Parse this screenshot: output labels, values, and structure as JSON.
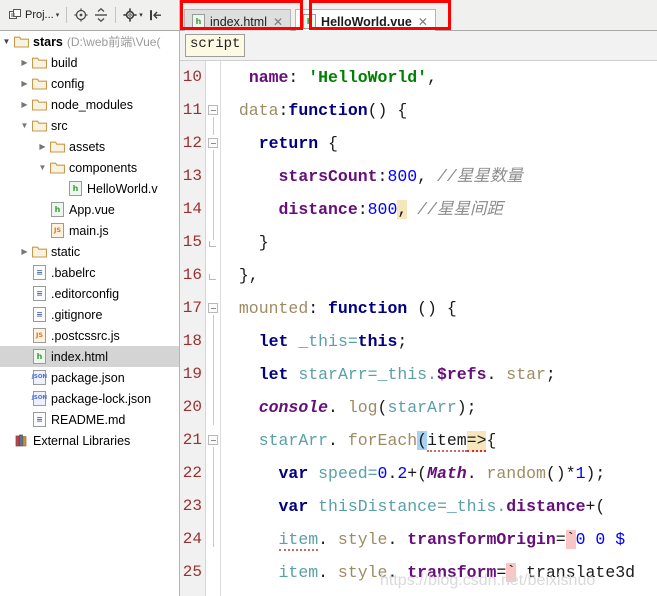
{
  "toolbar": {
    "project_button_label": "Proj...",
    "caret_glyph": "▾",
    "icons": [
      "project-dropdown-icon",
      "locate-target-icon",
      "collapse-all-icon",
      "settings-gear-icon",
      "hide-panel-icon"
    ]
  },
  "tabs": [
    {
      "label": "index.html",
      "icon": "html-file-icon",
      "icon_letter": "h",
      "close_glyph": "✕",
      "active": false,
      "annotated": true
    },
    {
      "label": "HelloWorld.vue",
      "icon": "vue-file-icon",
      "icon_letter": "h",
      "close_glyph": "✕",
      "active": true,
      "annotated": true
    }
  ],
  "project_tree": {
    "root": {
      "label": "stars",
      "path": "(D:\\web前端\\Vue(",
      "arrow": "▼"
    },
    "items": [
      {
        "label": "build",
        "depth": 1,
        "arrow": "▶",
        "icon": "folder-icon"
      },
      {
        "label": "config",
        "depth": 1,
        "arrow": "▶",
        "icon": "folder-icon"
      },
      {
        "label": "node_modules",
        "depth": 1,
        "arrow": "▶",
        "icon": "folder-icon"
      },
      {
        "label": "src",
        "depth": 1,
        "arrow": "▼",
        "icon": "folder-icon"
      },
      {
        "label": "assets",
        "depth": 2,
        "arrow": "▶",
        "icon": "folder-icon"
      },
      {
        "label": "components",
        "depth": 2,
        "arrow": "▼",
        "icon": "folder-icon"
      },
      {
        "label": "HelloWorld.v",
        "depth": 3,
        "arrow": "",
        "icon": "vue-file-icon",
        "icon_letter": "h",
        "icon_kind": "vue"
      },
      {
        "label": "App.vue",
        "depth": 2,
        "arrow": "",
        "icon": "vue-file-icon",
        "icon_letter": "h",
        "icon_kind": "vue"
      },
      {
        "label": "main.js",
        "depth": 2,
        "arrow": "",
        "icon": "js-file-icon",
        "icon_letter": "JS",
        "icon_kind": "js"
      },
      {
        "label": "static",
        "depth": 1,
        "arrow": "▶",
        "icon": "folder-icon"
      },
      {
        "label": ".babelrc",
        "depth": 1,
        "arrow": "",
        "icon": "text-file-icon",
        "icon_letter": "≡",
        "icon_kind": "txt"
      },
      {
        "label": ".editorconfig",
        "depth": 1,
        "arrow": "",
        "icon": "text-file-icon",
        "icon_letter": "≡",
        "icon_kind": "txt"
      },
      {
        "label": ".gitignore",
        "depth": 1,
        "arrow": "",
        "icon": "text-file-icon",
        "icon_letter": "≡",
        "icon_kind": "txt"
      },
      {
        "label": ".postcssrc.js",
        "depth": 1,
        "arrow": "",
        "icon": "js-file-icon",
        "icon_letter": "JS",
        "icon_kind": "js"
      },
      {
        "label": "index.html",
        "depth": 1,
        "arrow": "",
        "icon": "html-file-icon",
        "icon_letter": "h",
        "icon_kind": "vue",
        "selected": true
      },
      {
        "label": "package.json",
        "depth": 1,
        "arrow": "",
        "icon": "json-file-icon",
        "icon_letter": "JSON",
        "icon_kind": "json"
      },
      {
        "label": "package-lock.json",
        "depth": 1,
        "arrow": "",
        "icon": "json-file-icon",
        "icon_letter": "JSON",
        "icon_kind": "json"
      },
      {
        "label": "README.md",
        "depth": 1,
        "arrow": "",
        "icon": "text-file-icon",
        "icon_letter": "≡",
        "icon_kind": "txt"
      },
      {
        "label": "External Libraries",
        "depth": 0,
        "arrow": "",
        "icon": "libraries-icon"
      }
    ]
  },
  "editor": {
    "breadcrumb": "script",
    "first_line_number": 10,
    "line_numbers": [
      10,
      11,
      12,
      13,
      14,
      15,
      16,
      17,
      18,
      19,
      20,
      21,
      22,
      23,
      24,
      25
    ],
    "lines": {
      "l10": {
        "prop": "name",
        "colon": ": ",
        "string": "'HelloWorld'",
        "comma": ","
      },
      "l11": {
        "key": "data",
        "colon": ":",
        "fn": "function",
        "rest": "() {"
      },
      "l12": {
        "kw": "return",
        "rest": " {"
      },
      "l13": {
        "prop": "starsCount",
        "colon": ":",
        "num": "800",
        "comma": ",",
        "comment": "//星星数量"
      },
      "l14": {
        "prop": "distance",
        "colon": ":",
        "num": "800",
        "comma": ",",
        "comment": "//星星间距"
      },
      "l15": {
        "text": "}"
      },
      "l16": {
        "text": "},"
      },
      "l17": {
        "key": "mounted",
        "colon": ": ",
        "fn": "function",
        "rest": " () {"
      },
      "l18": {
        "kw": "let",
        "var": " _this=",
        "this": "this",
        "semi": ";"
      },
      "l19": {
        "kw": "let",
        "var": " starArr=_this.",
        "refs": "$refs",
        "dot": ".",
        "star": " star",
        "semi": ";"
      },
      "l20": {
        "global": "console",
        "dot": ".",
        "method": " log",
        "open": "(",
        "arg": "starArr",
        "close": ")",
        "semi": ";"
      },
      "l21": {
        "obj": "starArr",
        "dot": ".",
        "method": " forEach",
        "paren": "(",
        "param": "item",
        "arrow": "=>",
        "brace": "{"
      },
      "l22": {
        "kw": "var",
        "name": " speed=",
        "n1": "0",
        "dot": ".",
        "n2": "2",
        "plus": "+(",
        "math": "Math",
        "dot2": ".",
        "rand": " random",
        "tail": "()*",
        "n3": "1",
        "end": ");"
      },
      "l23": {
        "kw": "var",
        "name": " thisDistance=_this.",
        "field": "distance",
        "tail": "+("
      },
      "l24": {
        "obj": "item",
        "dot": ".",
        "prop2": " style",
        "dot2": ".",
        "field": " transformOrigin",
        "eq": "=",
        "tick": "`",
        "val": "0 0 $"
      },
      "l25": {
        "obj": "item",
        "dot": ".",
        "prop2": " style",
        "dot2": ".",
        "field": " transform",
        "eq": "=",
        "tick": "`",
        "val": " translate3d"
      }
    },
    "watermark": "https://blog.csdn.net/beixishuo"
  },
  "colors": {
    "annotation_red": "#fe0000",
    "keyword_blue": "#000080",
    "string_green": "#008000",
    "property_purple": "#660e7a",
    "number_blue": "#0000ff",
    "comment_gray": "#8c8c8c",
    "gutter_line_number": "#9a3131",
    "selection_gray": "#d4d4d4",
    "caret_highlight": "#f5e6bb",
    "brace_highlight": "#a6d2f5",
    "tick_highlight": "#fac5c5"
  }
}
